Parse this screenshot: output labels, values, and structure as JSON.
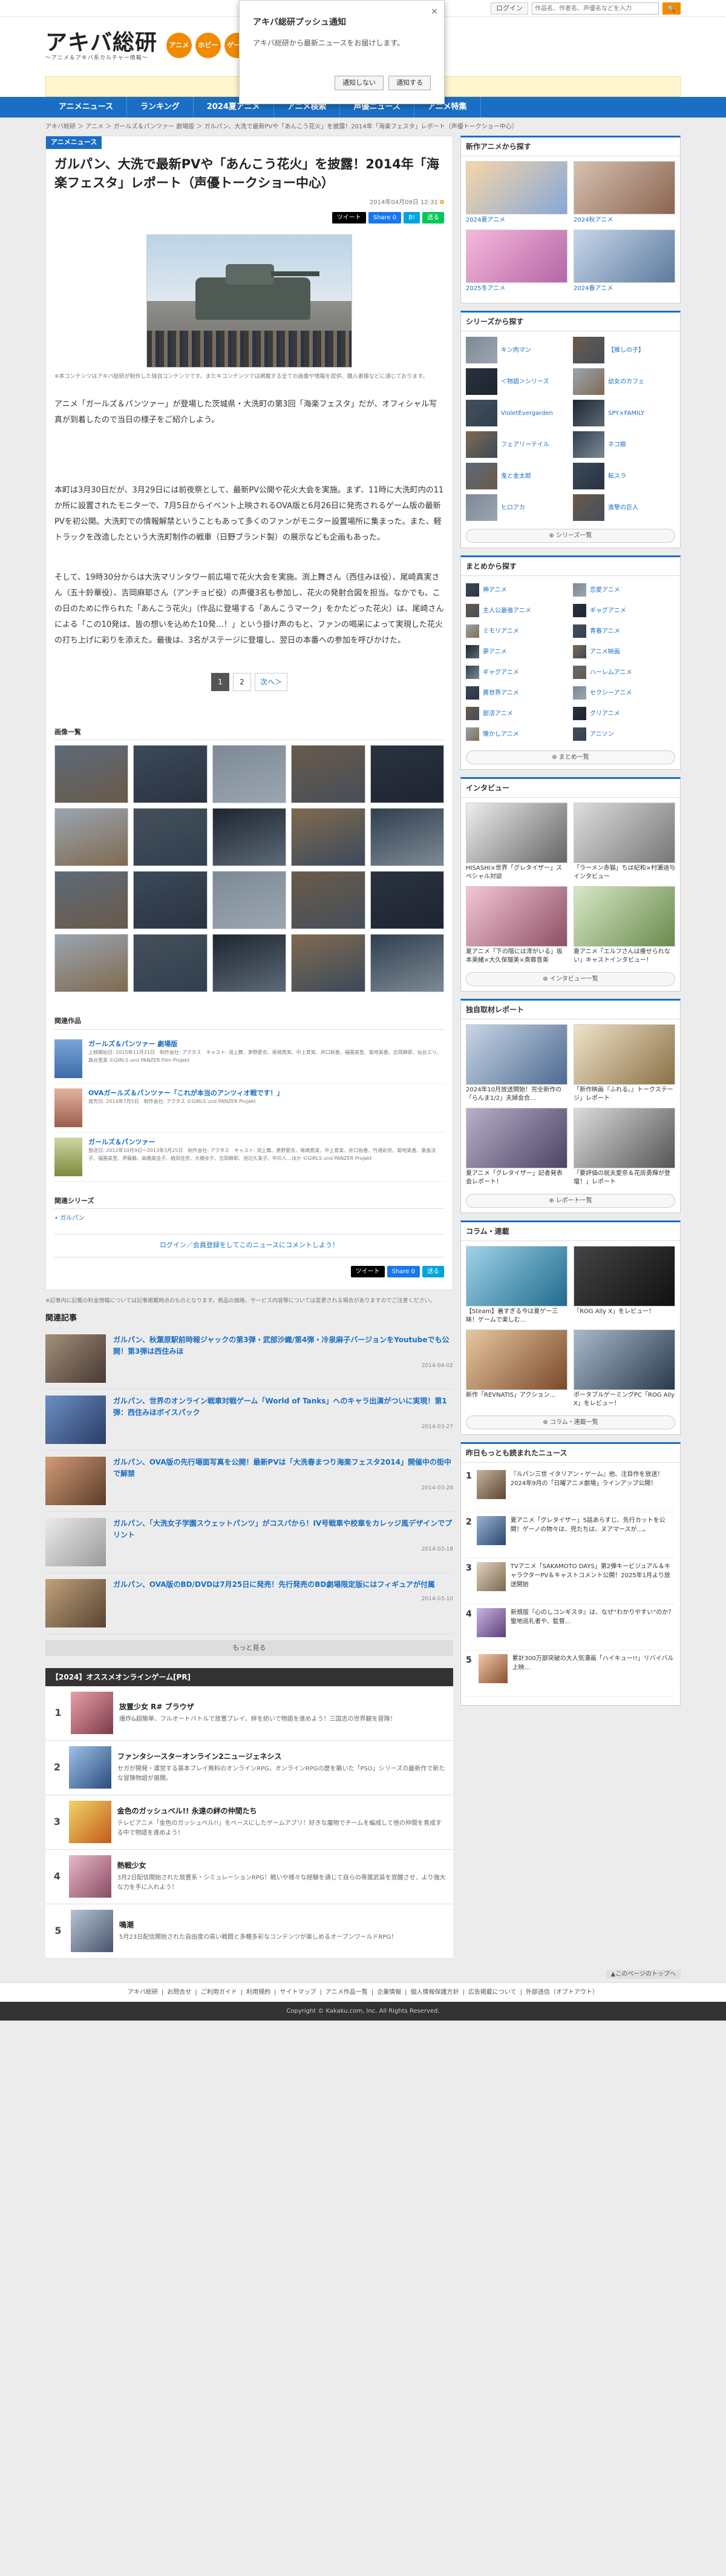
{
  "util": {
    "login": "ログイン",
    "search_placeholder": "作品名、作者名、声優名などを入力",
    "search_btn": "🔍"
  },
  "logo": {
    "main": "アキバ総研",
    "sub": "〜アニメ＆アキバ系カルチャー情報〜"
  },
  "circles": [
    "アニメ",
    "ホビー",
    "ゲーム"
  ],
  "push": {
    "title": "アキバ総研プッシュ通知",
    "message": "アキバ総研から最新ニュースをお届けします。",
    "deny": "通知しない",
    "allow": "通知する",
    "close": "×"
  },
  "nav": [
    "アニメニュース",
    "ランキング",
    "2024夏アニメ",
    "アニメ検索",
    "声優ニュース",
    "アニメ特集"
  ],
  "breadcrumb": "アキバ総研 ＞ アニメ ＞ ガールズ＆パンツァー 劇場版 ＞ ガルパン、大洗で最新PVや「あんこう花火」を披露！2014年「海楽フェスタ」レポート（声優トークショー中心）",
  "article": {
    "category": "アニメニュース",
    "title": "ガルパン、大洗で最新PVや「あんこう花火」を披露！2014年「海楽フェスタ」レポート（声優トークショー中心）",
    "date": "2014年04月09日 12:31",
    "comments": "0",
    "share": [
      "ツイート",
      "Share 0",
      "B!",
      "送る"
    ],
    "image_note": "※本コンテンツはアキバ総研が制作した独自コンテンツです。またキコンテンツでは掲載する全ての画像や情報を提供、購入者様などに通じております。",
    "para1": "アニメ「ガールズ＆パンツァー」が登場した茨城県・大洗町の第3回「海楽フェスタ」だが、オフィシャル写真が到着したので当日の様子をご紹介しよう。",
    "para2": "本町は3月30日だが、3月29日には前夜祭として、最新PV公開や花火大会を実施。まず、11時に大洗町内の11か所に設置されたモニターで、7月5日からイベント上映されるOVA版と6月26日に発売されるゲーム版の最新PVを初公開。大洗町での情報解禁ということもあって多くのファンがモニター設置場所に集まった。また、軽トラックを改造したという大洗町制作の戦車（日野ブランド製）の展示なども企画もあった。",
    "para3": "そして、19時30分からは大洗マリンタワー前広場で花火大会を実施。渕上舞さん（西住みほ役）、尾崎真実さん（五十鈴華役）、吉岡麻耶さん（アンチョビ役）の声優3名も参加し、花火の発射合図を担当。なかでも、この日のために作られた「あんこう花火」（作品に登場する「あんこうマーク」をかたどった花火）は、尾崎さんによる「この10発は、皆の想いを込めた10発…！」という掛け声のもと、ファンの喝采によって実現した花火の打ち上げに彩りを添えた。最後は、3名がステージに登壇し、翌日の本番への参加を呼びかけた。",
    "pager": [
      "1",
      "2",
      "次へ＞"
    ]
  },
  "gallery": {
    "heading": "画像一覧",
    "count": 20
  },
  "related_works": {
    "heading": "関連作品",
    "items": [
      {
        "title": "ガールズ＆パンツァー 劇場版",
        "desc": "上映開始日: 2015年11月21日　制作会社: アクタス　キャスト: 渕上舞、茅野愛衣、尾崎真実、中上育実、井口裕香、福圓美里、菊地美香、吉岡麻耶、仙台エリ、森谷里美 ©GIRLS und PANZER Film Projekt"
      },
      {
        "title": "OVAガールズ＆パンツァー「これが本当のアンツィオ戦です！」",
        "desc": "発売日: 2014年7月5日　制作会社: アクタス ©GIRLS und PANZER Projekt"
      },
      {
        "title": "ガールズ＆パンツァー",
        "desc": "放送日: 2012年10月9日～2013年3月25日　制作会社: アクタス　キャスト: 渕上舞、茅野愛衣、尾崎真実、中上育実、井口裕香、竹達彩奈、菊地美香、桑島法子、福圓美里、伊藤静、高橋美佳子、植田佳奈、大橋歩夕、吉岡麻耶、池辺久美子、中の人…ほか ©GIRLS und PANZER Projekt"
      }
    ]
  },
  "series": {
    "heading": "関連シリーズ",
    "item": "ガルパン"
  },
  "comment_link": "ログイン／会員登録をしてこのニュースにコメントしよう！",
  "footnote": "※記事内に記載の料金情報については記事掲載時点のものとなります。商品の価格、サービス内容等については変更される場合がありますのでご注意ください。",
  "related": {
    "heading": "関連記事",
    "items": [
      {
        "title": "ガルパン、秋葉原駅前時報ジャックの第3弾・武部沙織/第4弾・冷泉麻子バージョンをYoutubeでも公開！第3弾は西住みほ",
        "date": "2014-04-02"
      },
      {
        "title": "ガルパン、世界のオンライン戦車対戦ゲーム「World of Tanks」へのキャラ出演がついに実現！第1弾：西住みほボイスパック",
        "date": "2014-03-27"
      },
      {
        "title": "ガルパン、OVA版の先行場面写真を公開！最新PVは「大洗春まつり海楽フェスタ2014」開催中の街中で解禁",
        "date": "2014-03-28"
      },
      {
        "title": "ガルパン、「大洗女子学園スウェットパンツ」がコスパから！IV号戦車や校章をカレッジ風デザインでプリント",
        "date": "2014-03-18"
      },
      {
        "title": "ガルパン、OVA版のBD/DVDは7月25日に発売！先行発売のBD劇場限定版にはフィギュアが付属",
        "date": "2014-03-10"
      }
    ],
    "more": "もっと見る"
  },
  "ranking": {
    "heading": "【2024】オススメオンラインゲーム[PR]",
    "items": [
      {
        "num": "1",
        "title": "放置少女 R# ブラウザ",
        "desc": "爆炸&超簡単、フルオートバトルで放置プレイ。絆を紡いで物語を進めよう！三国志の世界観を冒険！"
      },
      {
        "num": "2",
        "title": "ファンタシースターオンライン2ニュージェネシス",
        "desc": "セガが開発・運営する基本プレイ無料のオンラインRPG。オンラインRPGの歴を築いた「PSO」シリーズの最新作で新たな冒険物語が展開。"
      },
      {
        "num": "3",
        "title": "金色のガッシュベル!! 永遠の絆の仲間たち",
        "desc": "テレビアニメ「金色のガッシュベル!!」をベースにしたゲームアプリ！好きな魔物でチームを編成して他の仲間を育成する中で物語を進めよう！"
      },
      {
        "num": "4",
        "title": "熱戦少女",
        "desc": "3月2日配信開始された放置系・シミュレーションRPG！戦いや様々な経験を通じて自らの専属武装を覚醒させ、より強大な力を手に入れよう！"
      },
      {
        "num": "5",
        "title": "鳴潮",
        "desc": "5月23日配信開始された自由度の高い戦闘と多種多彩なコンテンツが楽しめるオープンワールドRPG！"
      }
    ]
  },
  "side": {
    "new_anime": {
      "heading": "新作アニメから探す",
      "items": [
        "2024夏アニメ",
        "2024秋アニメ",
        "2025冬アニメ",
        "2024春アニメ"
      ],
      "more": ""
    },
    "series": {
      "heading": "シリーズから探す",
      "items": [
        "キン肉マン",
        "【推しの子】",
        "＜物語＞シリーズ",
        "幼女のカフェ",
        "VioletEvergarden",
        "SPY×FAMILY",
        "フェアリーテイル",
        "ネコ娘",
        "鬼と金太郎",
        "転スラ",
        "ヒロアカ",
        "進撃の巨人"
      ],
      "more": "シリーズ一覧"
    },
    "matome": {
      "heading": "まとめから探す",
      "items": [
        "神アニメ",
        "恋愛アニメ",
        "主人公最強アニメ",
        "ギャグアニメ",
        "ミモリアニメ",
        "青春アニメ",
        "夢アニメ",
        "アニメ映画",
        "ギャグアニメ",
        "ハーレムアニメ",
        "異世界アニメ",
        "セクシーアニメ",
        "部活アニメ",
        "グリアニメ",
        "懐かしアニメ",
        "アニソン"
      ],
      "more": "まとめ一覧"
    },
    "interview": {
      "heading": "インタビュー",
      "items": [
        "HISASHI×世界「グレタイザー」スペシャル対談",
        "「ラーメン赤猫」ちは紀和×村瀬迪与インタビュー",
        "夏アニメ「下の階には澪がいる」坂本美緒×大久保瑠美×斎藤音美",
        "夏アニメ「エルフさんは痩せられない」キャストインタビュー！"
      ],
      "more": "インタビュー一覧"
    },
    "report": {
      "heading": "独自取材レポート",
      "items": [
        "2024年10月放送開始！完全新作の「らんま1/2」夫婦会合…",
        "「新作映画『ふれる。』トークステージ」レポート",
        "夏アニメ「グレタイザー」記者発表会レポート！",
        "「要評価の就夫愛奈＆花房勇輝が登壇！」レポート"
      ],
      "more": "レポート一覧"
    },
    "column": {
      "heading": "コラム・連載",
      "items": [
        "【Steam】暑すぎる今は夏ゲー三昧！ゲームで楽しむ…",
        "「ROG Ally X」をレビュー！",
        "新作「REVNATIS」アクション…",
        "ポータブルゲーミングPC「ROG Ally X」をレビュー！"
      ],
      "more": "コラム・連載一覧"
    },
    "popular": {
      "heading": "昨日もっとも読まれたニュース",
      "items": [
        {
          "num": "1",
          "text": "『ルパン三世 イタリアン・ゲーム』他、注目作を放送！2024年9月の「日曜アニメ劇場」ラインアップ公開！"
        },
        {
          "num": "2",
          "text": "夏アニメ「グレタイザー」5話あらすじ、先行カットを公開！ゲーノの物々は、兜たちは、ヌアマースが…。"
        },
        {
          "num": "3",
          "text": "TVアニメ「SAKAMOTO DAYS」第2弾キービジュアル＆キャラクターPV＆キャストコメント公開！2025年1月より放送開始"
        },
        {
          "num": "4",
          "text": "新規版『心のしコンギスタ』は、なぜ“わかりやすい”のか？　聖地巡礼者や、監督…"
        },
        {
          "num": "5",
          "text": "累計300万部突破の大人気漫画「ハイキュー!!」リバイバル上映…"
        }
      ]
    }
  },
  "footer": {
    "pagetop": "▲このページのトップへ",
    "links": [
      "アキバ総研",
      "お問合せ",
      "ご利用ガイド",
      "利用規約",
      "サイトマップ",
      "アニメ作品一覧",
      "企業情報",
      "個人情報保護方針",
      "広告掲載について",
      "外部送信（オプトアウト）"
    ],
    "copyright": "Copyright © Kakaku.com, Inc. All Rights Reserved."
  },
  "colors": {
    "brand_blue": "#1a6fc4",
    "accent_orange": "#f08a00"
  }
}
